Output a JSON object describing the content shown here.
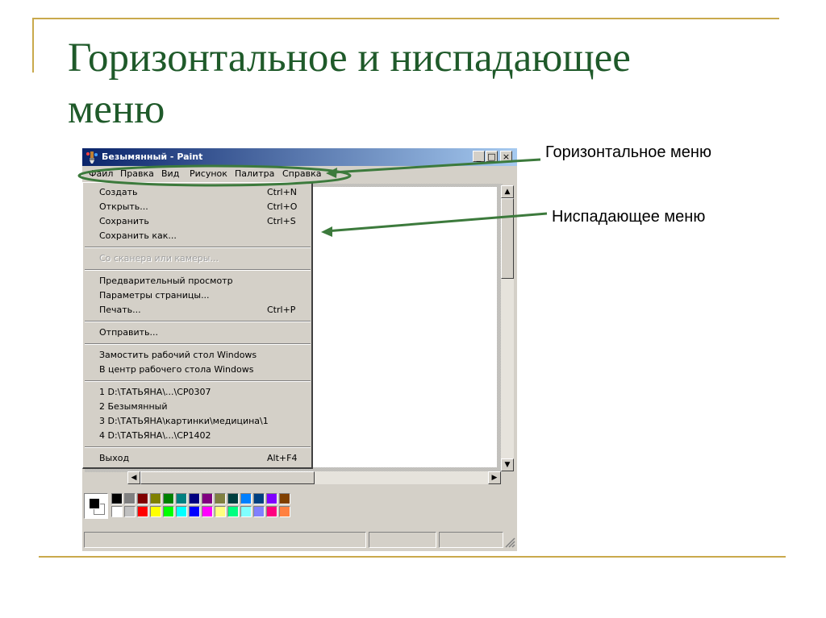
{
  "slide": {
    "title": "Горизонтальное и ниспадающее меню",
    "callout_horizontal": "Горизонтальное меню",
    "callout_dropdown": "Ниспадающее меню"
  },
  "colors": {
    "title_green": "#1f5a2a",
    "frame_gold": "#c9a94c",
    "annotation_green": "#3c7a3c",
    "titlebar_start": "#0a246a",
    "titlebar_end": "#a6caf0"
  },
  "window": {
    "title": "Безымянный - Paint",
    "icon": "paint-app-icon",
    "controls": {
      "minimize": "_",
      "maximize": "□",
      "close": "×"
    }
  },
  "menubar": [
    "Файл",
    "Правка",
    "Вид",
    "Рисунок",
    "Палитра",
    "Справка"
  ],
  "file_menu": [
    {
      "label": "Создать",
      "shortcut": "Ctrl+N"
    },
    {
      "label": "Открыть...",
      "shortcut": "Ctrl+O"
    },
    {
      "label": "Сохранить",
      "shortcut": "Ctrl+S"
    },
    {
      "label": "Сохранить как...",
      "shortcut": ""
    },
    {
      "label": "Со сканера или камеры...",
      "shortcut": "",
      "disabled": true
    },
    {
      "label": "Предварительный просмотр",
      "shortcut": ""
    },
    {
      "label": "Параметры страницы...",
      "shortcut": ""
    },
    {
      "label": "Печать...",
      "shortcut": "Ctrl+P"
    },
    {
      "label": "Отправить...",
      "shortcut": ""
    },
    {
      "label": "Замостить рабочий стол Windows",
      "shortcut": ""
    },
    {
      "label": "В центр рабочего стола Windows",
      "shortcut": ""
    },
    {
      "label": "1 D:\\ТАТЬЯНА\\...\\CP0307",
      "shortcut": ""
    },
    {
      "label": "2 Безымянный",
      "shortcut": ""
    },
    {
      "label": "3 D:\\ТАТЬЯНА\\картинки\\медицина\\1",
      "shortcut": ""
    },
    {
      "label": "4 D:\\ТАТЬЯНА\\...\\CP1402",
      "shortcut": ""
    },
    {
      "label": "Выход",
      "shortcut": "Alt+F4"
    }
  ],
  "palette": {
    "current_foreground": "#000000",
    "current_background": "#ffffff",
    "row1": [
      "#000000",
      "#808080",
      "#800000",
      "#808000",
      "#008000",
      "#008080",
      "#000080",
      "#800080",
      "#808040",
      "#004040",
      "#0080ff",
      "#004080",
      "#8000ff",
      "#804000"
    ],
    "row2": [
      "#ffffff",
      "#c0c0c0",
      "#ff0000",
      "#ffff00",
      "#00ff00",
      "#00ffff",
      "#0000ff",
      "#ff00ff",
      "#ffff80",
      "#00ff80",
      "#80ffff",
      "#8080ff",
      "#ff0080",
      "#ff8040"
    ]
  }
}
